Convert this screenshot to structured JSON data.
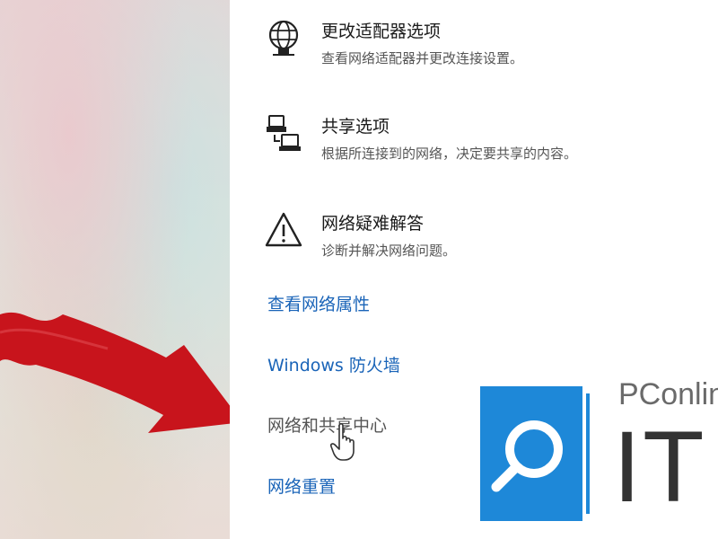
{
  "options": [
    {
      "title": "更改适配器选项",
      "desc": "查看网络适配器并更改连接设置。",
      "icon": "network-adapter-icon"
    },
    {
      "title": "共享选项",
      "desc": "根据所连接到的网络，决定要共享的内容。",
      "icon": "sharing-icon"
    },
    {
      "title": "网络疑难解答",
      "desc": "诊断并解决网络问题。",
      "icon": "warning-icon"
    }
  ],
  "links": [
    {
      "label": "查看网络属性"
    },
    {
      "label": "Windows 防火墙"
    },
    {
      "label": "网络和共享中心"
    },
    {
      "label": "网络重置"
    }
  ],
  "watermark": {
    "brand": "PConline",
    "it": "IT"
  },
  "colors": {
    "link": "#1a64b8",
    "arrow": "#c8141c",
    "logo_blue": "#1e88d8"
  }
}
